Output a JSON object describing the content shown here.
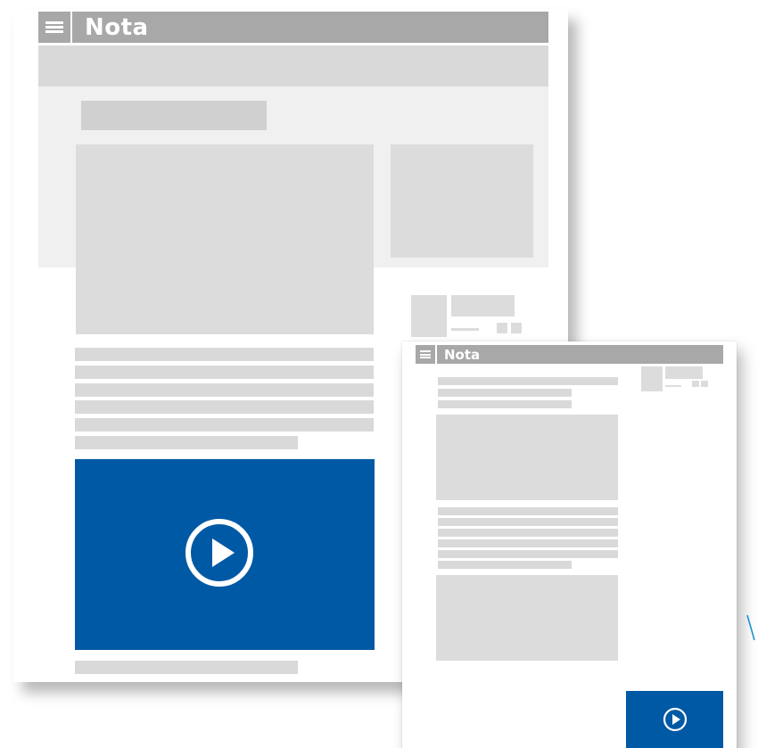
{
  "desktop": {
    "title": "Nota",
    "menu_icon": "hamburger-menu-icon",
    "video_icon": "play-circle-icon"
  },
  "mobile": {
    "title": "Nota",
    "menu_icon": "hamburger-menu-icon",
    "video_icon": "play-circle-icon"
  },
  "colors": {
    "header": "#a8a8a8",
    "placeholder": "#dcdcdc",
    "hero_band": "#f0f0f0",
    "video_bg": "#0059a4",
    "accent": "#1e90d6"
  }
}
